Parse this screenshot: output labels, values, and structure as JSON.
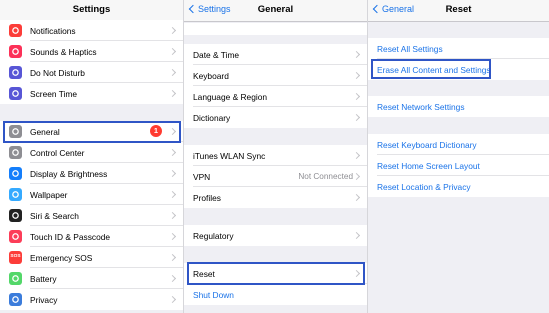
{
  "colors": {
    "accent": "#1a73e8",
    "highlight": "#2f55c6",
    "badge": "#ff3b30",
    "group_bg": "#efeff4"
  },
  "settings": {
    "title": "Settings",
    "items": [
      {
        "label": "Notifications",
        "icon": "notifications-icon",
        "color": "#fc3d39"
      },
      {
        "label": "Sounds & Haptics",
        "icon": "sounds-icon",
        "color": "#fc3158"
      },
      {
        "label": "Do Not Disturb",
        "icon": "moon-icon",
        "color": "#5856d6"
      },
      {
        "label": "Screen Time",
        "icon": "hourglass-icon",
        "color": "#5856d6"
      },
      {
        "label": "General",
        "icon": "gear-icon",
        "color": "#8e8e93",
        "badge": "1"
      },
      {
        "label": "Control Center",
        "icon": "toggles-icon",
        "color": "#8e8e93"
      },
      {
        "label": "Display & Brightness",
        "icon": "text-size-icon",
        "color": "#147efb"
      },
      {
        "label": "Wallpaper",
        "icon": "flower-icon",
        "color": "#35aaff"
      },
      {
        "label": "Siri & Search",
        "icon": "siri-icon",
        "color": "#222222"
      },
      {
        "label": "Touch ID & Passcode",
        "icon": "fingerprint-icon",
        "color": "#fc3d58"
      },
      {
        "label": "Emergency SOS",
        "icon": "sos-icon",
        "color": "#fc3d39",
        "text": "SOS"
      },
      {
        "label": "Battery",
        "icon": "battery-icon",
        "color": "#53d769"
      },
      {
        "label": "Privacy",
        "icon": "hand-icon",
        "color": "#3b7cdb"
      }
    ]
  },
  "general": {
    "back_label": "Settings",
    "title": "General",
    "items": [
      {
        "label": "Date & Time"
      },
      {
        "label": "Keyboard"
      },
      {
        "label": "Language & Region"
      },
      {
        "label": "Dictionary"
      },
      {
        "label": "iTunes WLAN Sync"
      },
      {
        "label": "VPN",
        "value": "Not Connected"
      },
      {
        "label": "Profiles"
      },
      {
        "label": "Regulatory"
      },
      {
        "label": "Reset"
      },
      {
        "label": "Shut Down"
      }
    ]
  },
  "reset": {
    "back_label": "General",
    "title": "Reset",
    "items": [
      {
        "label": "Reset All Settings"
      },
      {
        "label": "Erase All Content and Settings"
      },
      {
        "label": "Reset Network Settings"
      },
      {
        "label": "Reset Keyboard Dictionary"
      },
      {
        "label": "Reset Home Screen Layout"
      },
      {
        "label": "Reset Location & Privacy"
      }
    ]
  }
}
